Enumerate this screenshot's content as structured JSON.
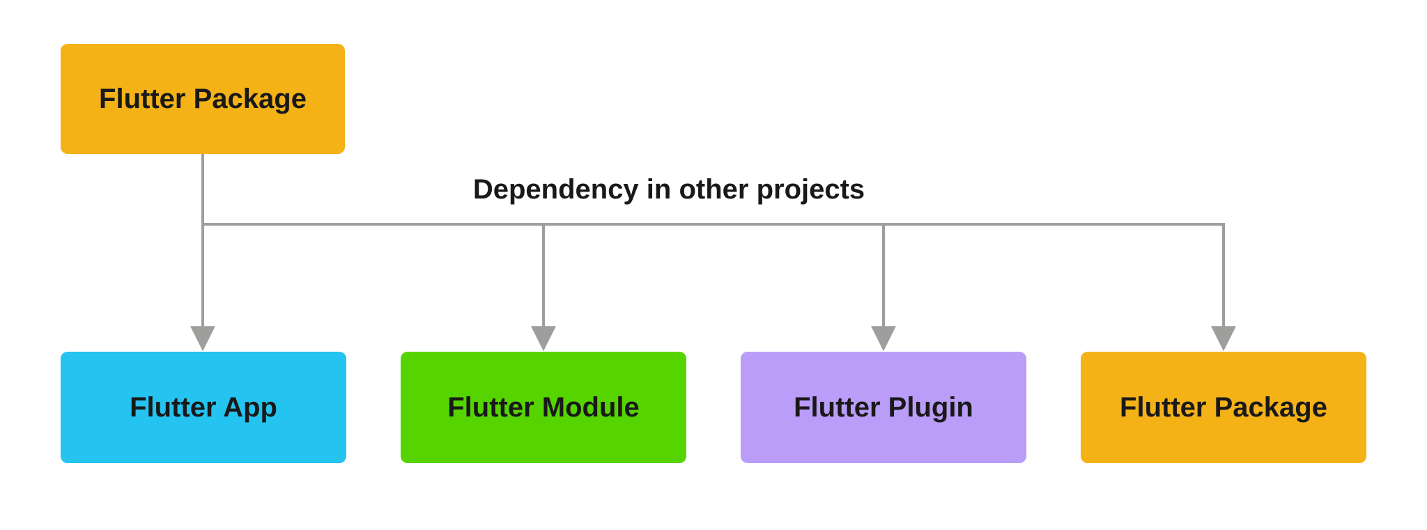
{
  "diagram": {
    "root": {
      "label": "Flutter Package",
      "color": "#F4B217"
    },
    "annotation": "Dependency in other projects",
    "children": [
      {
        "label": "Flutter App",
        "color": "#25C3F0"
      },
      {
        "label": "Flutter Module",
        "color": "#56D400"
      },
      {
        "label": "Flutter Plugin",
        "color": "#B99DF8"
      },
      {
        "label": "Flutter Package",
        "color": "#F4B217"
      }
    ],
    "connector_color": "#9E9E9D"
  }
}
